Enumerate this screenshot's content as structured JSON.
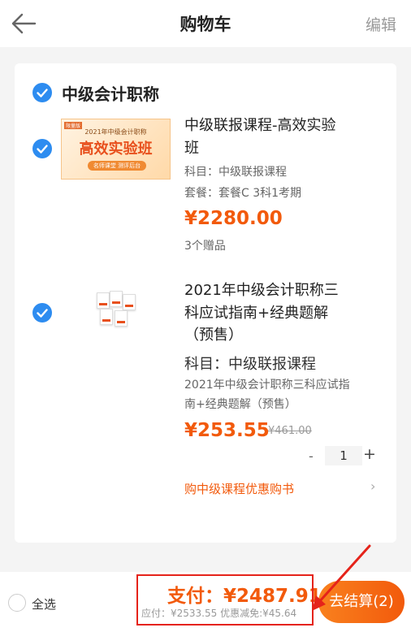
{
  "header": {
    "title": "购物车",
    "edit_label": "编辑"
  },
  "group": {
    "title": "中级会计职称",
    "checked": true
  },
  "items": [
    {
      "name_line1": "中级联报课程-高效实验",
      "name_line2": "班",
      "subject": "科目：中级联报课程",
      "package": "套餐：套餐C 3科1考期",
      "price": "¥2280.00",
      "gifts": "3个赠品",
      "thumb": {
        "tag": "限量版",
        "line1": "2021年中级会计职称",
        "line2": "高效实验班",
        "line3": "名师课堂 测评后台"
      },
      "checked": true
    },
    {
      "name_line1": "2021年中级会计职称三",
      "name_line2": "科应试指南+经典题解",
      "name_line3": "（预售）",
      "subject": "科目：中级联报课程",
      "desc_line1": "2021年中级会计职称三科应试指",
      "desc_line2": "南+经典题解（预售）",
      "price": "¥253.55",
      "original_price": "¥461.00",
      "quantity": "1",
      "minus_label": "-",
      "plus_label": "+",
      "checked": true
    }
  ],
  "promo": {
    "label": "购中级课程优惠购书",
    "chevron": "›"
  },
  "footer": {
    "select_all_label": "全选",
    "pay_label": "支付：¥2487.91",
    "subtotal_label": "应付：¥2533.55 优惠减免:¥45.64",
    "checkout_label": "去结算(2)"
  },
  "colors": {
    "accent": "#f25a0c",
    "check": "#2d8cf0",
    "annotation": "#e5231a"
  }
}
